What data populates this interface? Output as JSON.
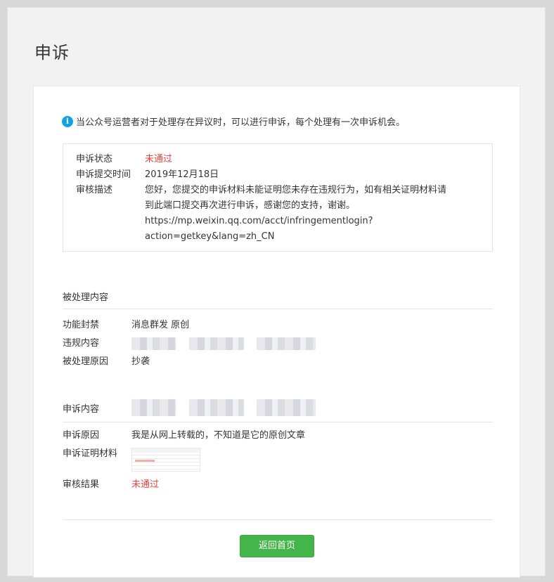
{
  "page": {
    "title": "申诉"
  },
  "notice": {
    "icon": "info-icon",
    "text": "当公众号运营者对于处理存在异议时，可以进行申诉，每个处理有一次申诉机会。"
  },
  "status_box": {
    "status_label": "申诉状态",
    "status_value": "未通过",
    "time_label": "申诉提交时间",
    "time_value": "2019年12月18日",
    "desc_label": "审核描述",
    "desc_lines": [
      "您好，您提交的申诉材料未能证明您未存在违规行为，如有相关证明材料请",
      "到此端口提交再次进行申诉，感谢您的支持，谢谢。",
      "https://mp.weixin.qq.com/acct/infringementlogin?",
      "action=getkey&lang=zh_CN"
    ]
  },
  "processed": {
    "section_title": "被处理内容",
    "function_label": "功能封禁",
    "function_value": "消息群发 原创",
    "violation_label": "违规内容",
    "reason_label": "被处理原因",
    "reason_value": "抄袭"
  },
  "appeal": {
    "section_title": "申诉内容",
    "reason_label": "申诉原因",
    "reason_value": "我是从网上转载的，不知道是它的原创文章",
    "evidence_label": "申诉证明材料",
    "result_label": "审核结果",
    "result_value": "未通过"
  },
  "actions": {
    "home_label": "返回首页"
  },
  "colors": {
    "accent_green": "#44b549",
    "status_red": "#e64340",
    "info_blue": "#0fa3e0"
  }
}
